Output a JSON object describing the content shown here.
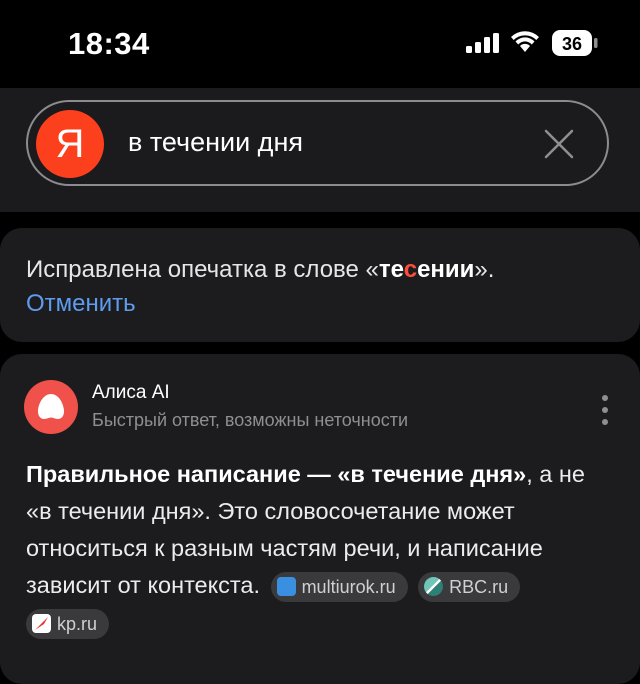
{
  "status_bar": {
    "time": "18:34",
    "battery": "36"
  },
  "search": {
    "logo_letter": "Я",
    "query": "в течении дня",
    "brand_color": "#fc3f1d"
  },
  "typo": {
    "prefix": "Исправлена опечатка в слове «",
    "word_part1": "те",
    "word_highlight": "с",
    "word_part2": "ении",
    "suffix": "».",
    "undo_label": "Отменить",
    "highlight_color": "#ff4d3a",
    "link_color": "#5e9cf0"
  },
  "ai_answer": {
    "name": "Алиса AI",
    "subtitle": "Быстрый ответ, возможны неточности",
    "bold_part": "Правильное написание — «в течение дня»",
    "text_part": ", а не «в течении дня». Это словосочетание может относиться к разным частям речи, и написание зависит от контекста.",
    "sources": [
      {
        "label": "multiurok.ru",
        "icon": "multiurok-icon"
      },
      {
        "label": "RBC.ru",
        "icon": "rbc-icon"
      },
      {
        "label": "kp.ru",
        "icon": "kp-icon"
      }
    ]
  }
}
